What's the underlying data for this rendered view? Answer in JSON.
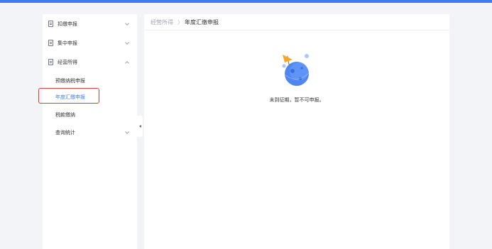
{
  "sidebar": {
    "menu": [
      {
        "label": "扣缴申报",
        "icon": "document-icon"
      },
      {
        "label": "集中申报",
        "icon": "document-icon"
      },
      {
        "label": "经营所得",
        "icon": "document-icon"
      }
    ],
    "submenu": [
      {
        "label": "预缴纳税申报"
      },
      {
        "label": "年度汇缴申报",
        "active": true
      },
      {
        "label": "税款缴纳"
      },
      {
        "label": "查询统计"
      }
    ]
  },
  "breadcrumb": {
    "parent": "经营所得",
    "separator": "〉",
    "current": "年度汇缴申报"
  },
  "empty_state": {
    "message": "未到征期，暂不可申报。",
    "icon": "planet-flag-illustration"
  },
  "colors": {
    "accent": "#3d7cf0",
    "highlight": "#e03b3b",
    "background": "#f2f4f7"
  }
}
